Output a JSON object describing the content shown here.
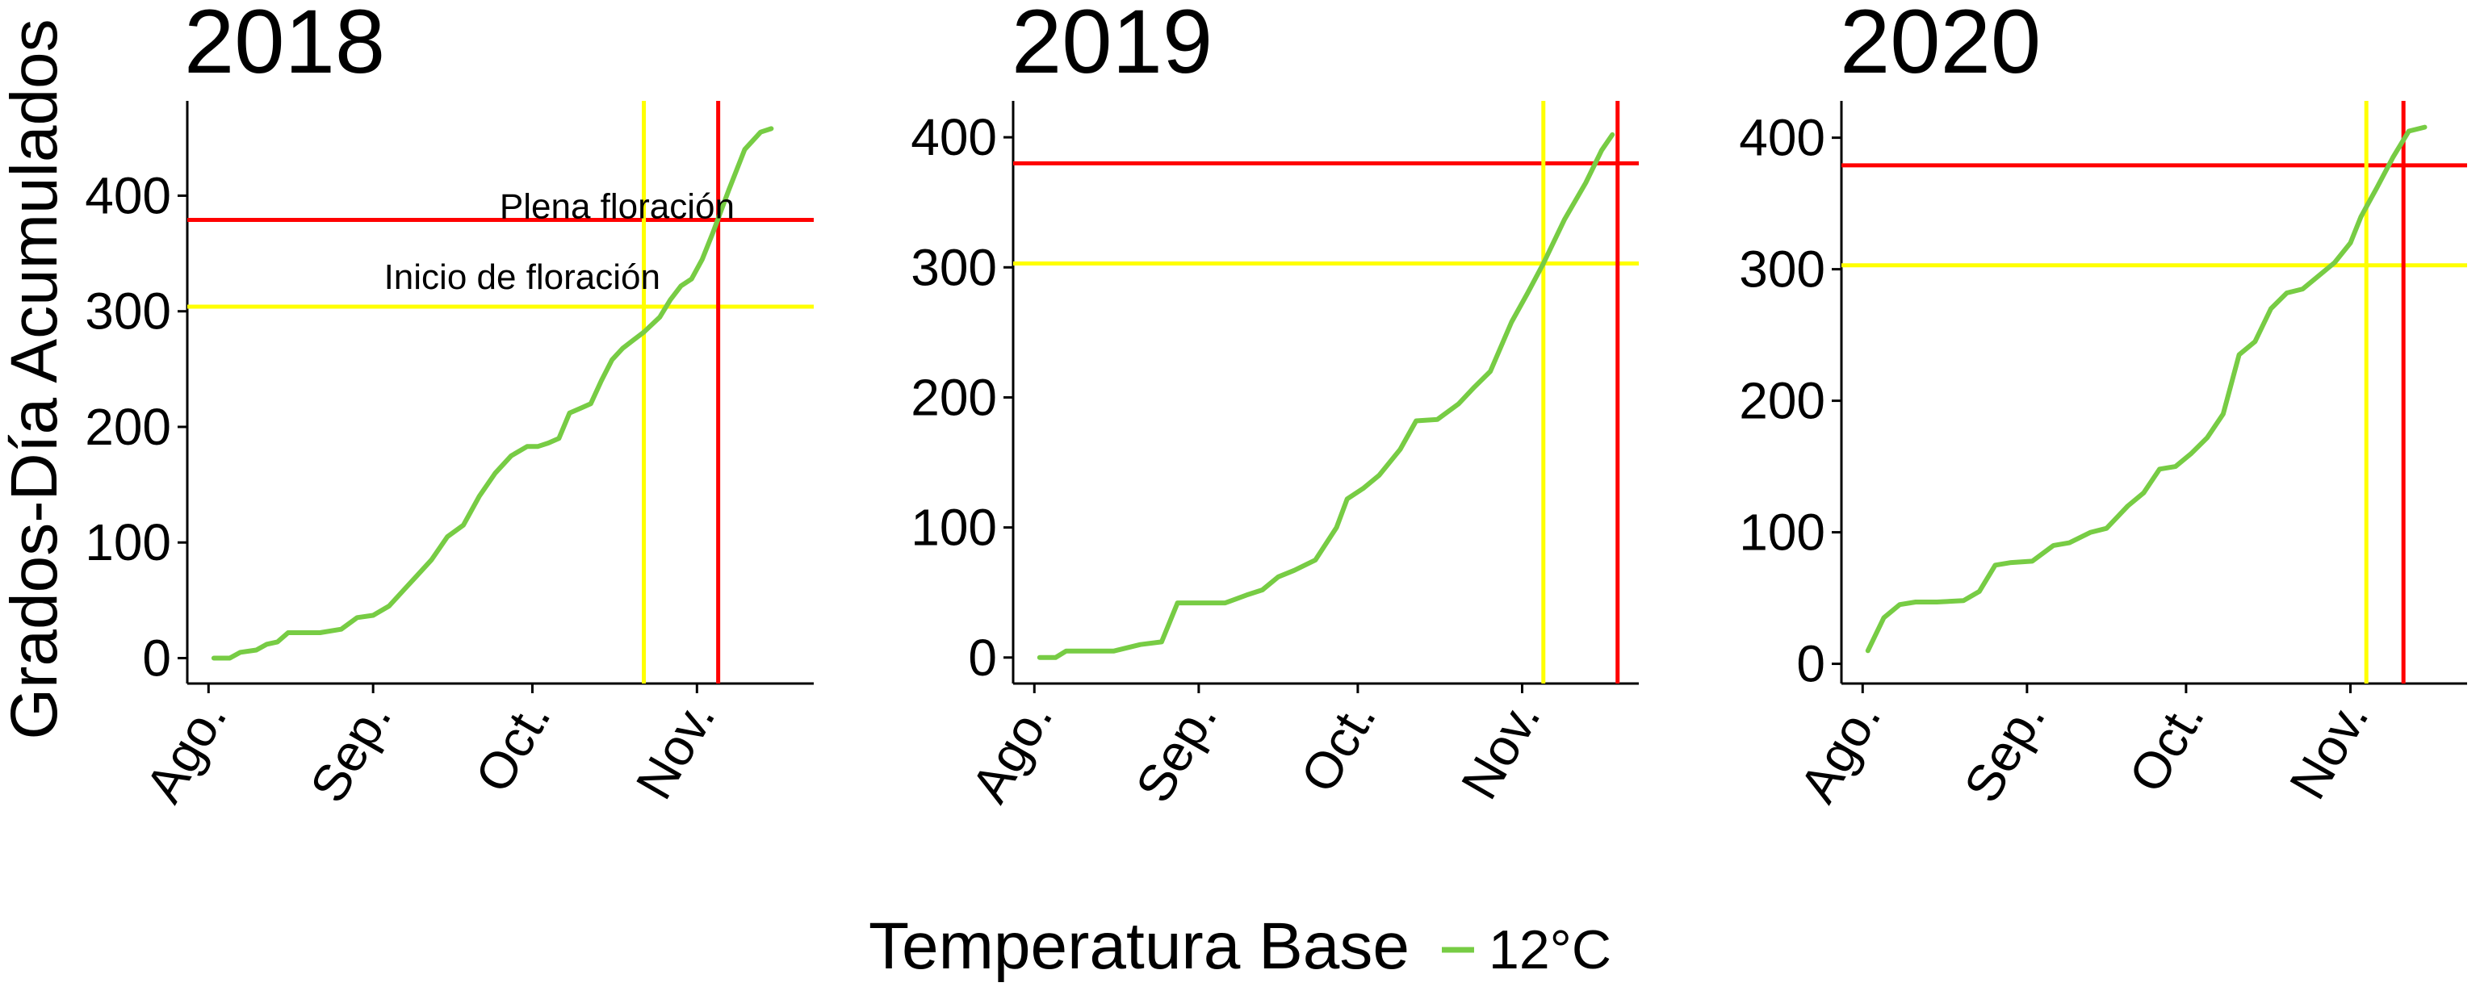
{
  "colors": {
    "series": "#77cc44",
    "flowering_start": "#ffff00",
    "full_flowering": "#ff0000",
    "axis": "#000000"
  },
  "ylabel": "Grados-Día Acumulados",
  "legend": {
    "title": "Temperatura Base",
    "series_label": "12°C"
  },
  "x_tick_labels": [
    "Ago.",
    "Sep.",
    "Oct.",
    "Nov."
  ],
  "chart_data": [
    {
      "type": "line",
      "title": "2018",
      "ylabel": "Grados-Día Acumulados",
      "xlim": [
        "2018-07-28",
        "2018-11-23"
      ],
      "ylim": [
        -22,
        482
      ],
      "x_ticks": [
        "2018-08-01",
        "2018-09-01",
        "2018-10-01",
        "2018-11-01"
      ],
      "x_tick_labels": [
        "Ago.",
        "Sep.",
        "Oct.",
        "Nov."
      ],
      "y_ticks": [
        0,
        100,
        200,
        300,
        400
      ],
      "grid": false,
      "hlines": [
        {
          "y": 304,
          "color": "#ffff00",
          "label": "Inicio de floración"
        },
        {
          "y": 379,
          "color": "#ff0000",
          "label": "Plena floración"
        }
      ],
      "vlines": [
        {
          "x": "2018-10-22",
          "color": "#ffff00"
        },
        {
          "x": "2018-11-05",
          "color": "#ff0000"
        }
      ],
      "series": [
        {
          "name": "12°C",
          "x": [
            "2018-08-02",
            "2018-08-05",
            "2018-08-07",
            "2018-08-10",
            "2018-08-12",
            "2018-08-14",
            "2018-08-16",
            "2018-08-19",
            "2018-08-22",
            "2018-08-26",
            "2018-08-29",
            "2018-09-01",
            "2018-09-04",
            "2018-09-07",
            "2018-09-09",
            "2018-09-12",
            "2018-09-15",
            "2018-09-18",
            "2018-09-21",
            "2018-09-24",
            "2018-09-27",
            "2018-09-30",
            "2018-10-02",
            "2018-10-04",
            "2018-10-06",
            "2018-10-08",
            "2018-10-10",
            "2018-10-12",
            "2018-10-14",
            "2018-10-16",
            "2018-10-18",
            "2018-10-20",
            "2018-10-22",
            "2018-10-25",
            "2018-10-27",
            "2018-10-29",
            "2018-10-31",
            "2018-11-02",
            "2018-11-04",
            "2018-11-07",
            "2018-11-10",
            "2018-11-13",
            "2018-11-15"
          ],
          "values": [
            0,
            0,
            5,
            7,
            12,
            14,
            22,
            22,
            22,
            25,
            35,
            37,
            45,
            60,
            70,
            85,
            105,
            115,
            140,
            160,
            175,
            183,
            183,
            186,
            190,
            212,
            216,
            220,
            240,
            258,
            268,
            275,
            282,
            295,
            310,
            322,
            328,
            345,
            368,
            405,
            440,
            455,
            458
          ]
        }
      ]
    },
    {
      "type": "line",
      "title": "2019",
      "ylabel": "",
      "xlim": [
        "2019-07-28",
        "2019-11-23"
      ],
      "ylim": [
        -20,
        428
      ],
      "x_ticks": [
        "2019-08-01",
        "2019-09-01",
        "2019-10-01",
        "2019-11-01"
      ],
      "x_tick_labels": [
        "Ago.",
        "Sep.",
        "Oct.",
        "Nov."
      ],
      "y_ticks": [
        0,
        100,
        200,
        300,
        400
      ],
      "grid": false,
      "hlines": [
        {
          "y": 303,
          "color": "#ffff00"
        },
        {
          "y": 380,
          "color": "#ff0000"
        }
      ],
      "vlines": [
        {
          "x": "2019-11-05",
          "color": "#ffff00"
        },
        {
          "x": "2019-11-19",
          "color": "#ff0000"
        }
      ],
      "series": [
        {
          "name": "12°C",
          "x": [
            "2019-08-02",
            "2019-08-05",
            "2019-08-07",
            "2019-08-12",
            "2019-08-16",
            "2019-08-21",
            "2019-08-25",
            "2019-08-28",
            "2019-09-02",
            "2019-09-06",
            "2019-09-10",
            "2019-09-13",
            "2019-09-16",
            "2019-09-19",
            "2019-09-23",
            "2019-09-27",
            "2019-09-29",
            "2019-10-02",
            "2019-10-05",
            "2019-10-09",
            "2019-10-12",
            "2019-10-16",
            "2019-10-20",
            "2019-10-23",
            "2019-10-26",
            "2019-10-30",
            "2019-11-02",
            "2019-11-05",
            "2019-11-09",
            "2019-11-13",
            "2019-11-16",
            "2019-11-18"
          ],
          "values": [
            0,
            0,
            5,
            5,
            5,
            10,
            12,
            42,
            42,
            42,
            48,
            52,
            62,
            67,
            75,
            100,
            122,
            130,
            140,
            160,
            182,
            183,
            195,
            208,
            220,
            258,
            280,
            303,
            337,
            365,
            390,
            402
          ]
        }
      ]
    },
    {
      "type": "line",
      "title": "2020",
      "ylabel": "",
      "xlim": [
        "2020-07-28",
        "2020-11-23"
      ],
      "ylim": [
        -15,
        428
      ],
      "x_ticks": [
        "2020-08-01",
        "2020-09-01",
        "2020-10-01",
        "2020-11-01"
      ],
      "x_tick_labels": [
        "Ago.",
        "Sep.",
        "Oct.",
        "Nov."
      ],
      "y_ticks": [
        0,
        100,
        200,
        300,
        400
      ],
      "grid": false,
      "hlines": [
        {
          "y": 303,
          "color": "#ffff00"
        },
        {
          "y": 379,
          "color": "#ff0000"
        }
      ],
      "vlines": [
        {
          "x": "2020-11-04",
          "color": "#ffff00"
        },
        {
          "x": "2020-11-11",
          "color": "#ff0000"
        }
      ],
      "series": [
        {
          "name": "12°C",
          "x": [
            "2020-08-02",
            "2020-08-05",
            "2020-08-08",
            "2020-08-11",
            "2020-08-15",
            "2020-08-20",
            "2020-08-23",
            "2020-08-26",
            "2020-08-29",
            "2020-09-02",
            "2020-09-06",
            "2020-09-09",
            "2020-09-13",
            "2020-09-16",
            "2020-09-20",
            "2020-09-23",
            "2020-09-26",
            "2020-09-29",
            "2020-10-02",
            "2020-10-05",
            "2020-10-08",
            "2020-10-11",
            "2020-10-14",
            "2020-10-17",
            "2020-10-20",
            "2020-10-23",
            "2020-10-26",
            "2020-10-29",
            "2020-11-01",
            "2020-11-03",
            "2020-11-06",
            "2020-11-09",
            "2020-11-12",
            "2020-11-15"
          ],
          "values": [
            10,
            35,
            45,
            47,
            47,
            48,
            55,
            75,
            77,
            78,
            90,
            92,
            100,
            103,
            120,
            130,
            148,
            150,
            160,
            172,
            190,
            235,
            245,
            270,
            282,
            285,
            295,
            305,
            320,
            340,
            362,
            385,
            405,
            408
          ]
        }
      ]
    }
  ]
}
